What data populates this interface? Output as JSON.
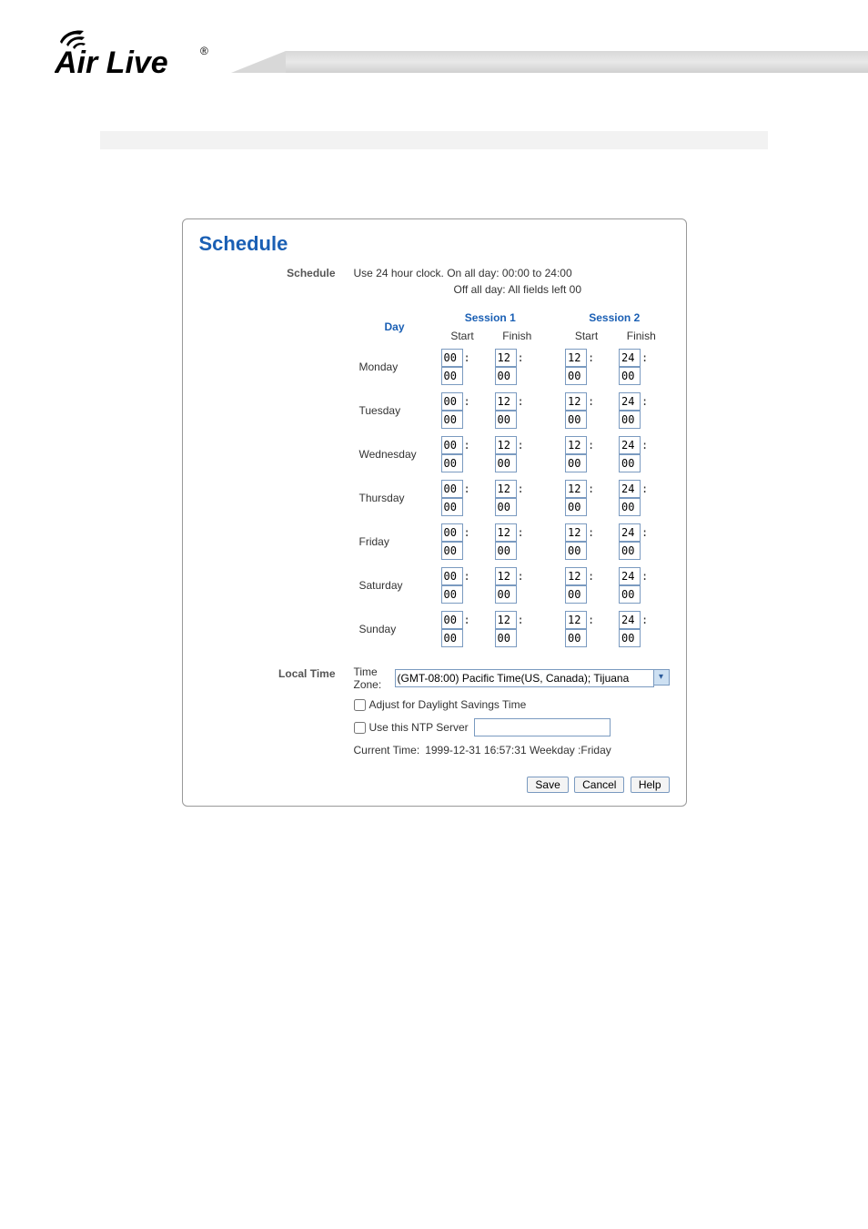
{
  "page": {
    "title": "Schedule",
    "schedule_label": "Schedule",
    "hint_line1": "Use 24 hour clock.   On all day: 00:00 to 24:00",
    "hint_line2": "Off all day: All fields left 00"
  },
  "table": {
    "day_header": "Day",
    "session1_header": "Session 1",
    "session2_header": "Session 2",
    "start_label": "Start",
    "finish_label": "Finish",
    "days": [
      {
        "name": "Monday",
        "s1s_h": "00",
        "s1s_m": "00",
        "s1f_h": "12",
        "s1f_m": "00",
        "s2s_h": "12",
        "s2s_m": "00",
        "s2f_h": "24",
        "s2f_m": "00"
      },
      {
        "name": "Tuesday",
        "s1s_h": "00",
        "s1s_m": "00",
        "s1f_h": "12",
        "s1f_m": "00",
        "s2s_h": "12",
        "s2s_m": "00",
        "s2f_h": "24",
        "s2f_m": "00"
      },
      {
        "name": "Wednesday",
        "s1s_h": "00",
        "s1s_m": "00",
        "s1f_h": "12",
        "s1f_m": "00",
        "s2s_h": "12",
        "s2s_m": "00",
        "s2f_h": "24",
        "s2f_m": "00"
      },
      {
        "name": "Thursday",
        "s1s_h": "00",
        "s1s_m": "00",
        "s1f_h": "12",
        "s1f_m": "00",
        "s2s_h": "12",
        "s2s_m": "00",
        "s2f_h": "24",
        "s2f_m": "00"
      },
      {
        "name": "Friday",
        "s1s_h": "00",
        "s1s_m": "00",
        "s1f_h": "12",
        "s1f_m": "00",
        "s2s_h": "12",
        "s2s_m": "00",
        "s2f_h": "24",
        "s2f_m": "00"
      },
      {
        "name": "Saturday",
        "s1s_h": "00",
        "s1s_m": "00",
        "s1f_h": "12",
        "s1f_m": "00",
        "s2s_h": "12",
        "s2s_m": "00",
        "s2f_h": "24",
        "s2f_m": "00"
      },
      {
        "name": "Sunday",
        "s1s_h": "00",
        "s1s_m": "00",
        "s1f_h": "12",
        "s1f_m": "00",
        "s2s_h": "12",
        "s2s_m": "00",
        "s2f_h": "24",
        "s2f_m": "00"
      }
    ]
  },
  "local_time": {
    "section_label": "Local Time",
    "tz_label": "Time Zone:",
    "tz_selected": "(GMT-08:00) Pacific Time(US, Canada); Tijuana",
    "dst_label": "Adjust for Daylight Savings Time",
    "ntp_label": "Use this NTP Server",
    "ntp_value": "",
    "current_label": "Current Time:",
    "current_value": "1999-12-31 16:57:31  Weekday :Friday"
  },
  "buttons": {
    "save": "Save",
    "cancel": "Cancel",
    "help": "Help"
  }
}
